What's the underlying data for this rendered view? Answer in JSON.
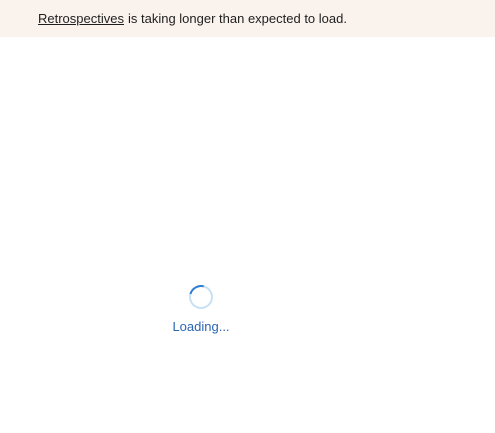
{
  "banner": {
    "link_text": "Retrospectives",
    "message": "is taking longer than expected to load."
  },
  "loader": {
    "status_text": "Loading..."
  },
  "colors": {
    "banner_background": "#faf2ed",
    "spinner_accent": "#2b7cd3",
    "loading_text": "#2b66b1"
  },
  "icons": {
    "spinner": "loading-spinner-icon"
  }
}
